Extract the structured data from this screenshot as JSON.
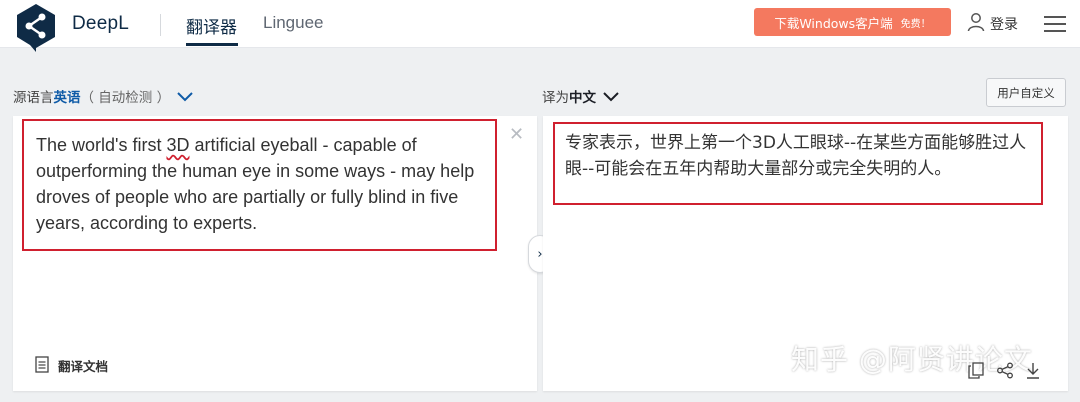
{
  "header": {
    "brand": "DeepL",
    "nav_translator": "翻译器",
    "nav_linguee": "Linguee",
    "download_button": "下载Windows客户端",
    "download_badge": "免费！",
    "login_label": "登录"
  },
  "source": {
    "label_prefix": "源语言",
    "language": "英语",
    "detect_hint": "（ 自动检测 ）",
    "text_before": "The world's first ",
    "text_flagged": "3D",
    "text_after": " artificial eyeball - capable of outperforming the human eye in some ways - may help droves of people who are partially or fully blind in five years, according to experts.",
    "document_label": "翻译文档"
  },
  "target": {
    "label_prefix": "译为",
    "language": "中文",
    "glossary_button": "用户自定义",
    "text": "专家表示，世界上第一个3D人工眼球--在某些方面能够胜过人眼--可能会在五年内帮助大量部分或完全失明的人。"
  },
  "watermark": "知乎 @阿贤讲论文",
  "icons": {
    "logo": "deepl-logo-icon",
    "user": "user-icon",
    "menu": "hamburger-menu-icon",
    "source_dropdown": "chevron-down-icon",
    "target_dropdown": "chevron-down-icon",
    "clear": "close-icon",
    "document": "document-icon",
    "swap": "chevron-right-icon",
    "copy": "copy-icon",
    "share": "share-icon",
    "download": "download-icon"
  },
  "colors": {
    "brand_navy": "#0f2b46",
    "download_button": "#f4795f",
    "highlight_box": "#d0202f",
    "source_language": "#0f5ba7"
  }
}
